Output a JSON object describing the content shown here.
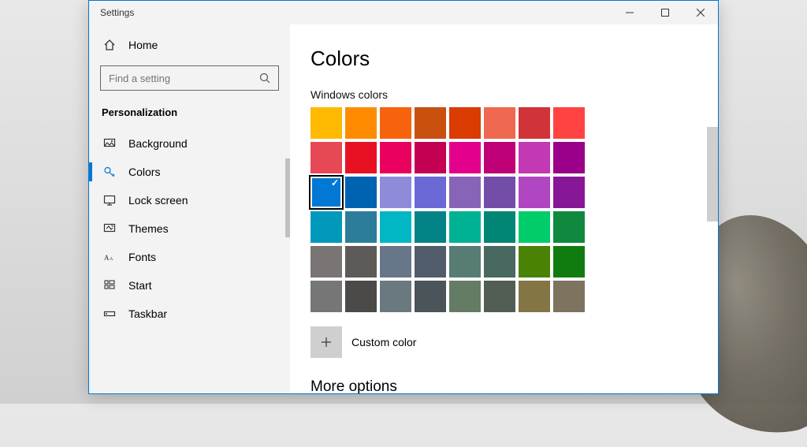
{
  "window": {
    "title": "Settings"
  },
  "sidebar": {
    "home_label": "Home",
    "search_placeholder": "Find a setting",
    "heading": "Personalization",
    "items": [
      {
        "label": "Background"
      },
      {
        "label": "Colors"
      },
      {
        "label": "Lock screen"
      },
      {
        "label": "Themes"
      },
      {
        "label": "Fonts"
      },
      {
        "label": "Start"
      },
      {
        "label": "Taskbar"
      }
    ],
    "active_index": 1
  },
  "content": {
    "title": "Colors",
    "swatch_heading": "Windows colors",
    "custom_label": "Custom color",
    "more_options": "More options",
    "selected_color_index": 16,
    "colors": [
      "#ffb900",
      "#ff8c00",
      "#f7630c",
      "#ca5010",
      "#da3b01",
      "#ef6950",
      "#d13438",
      "#ff4343",
      "#e74856",
      "#e81123",
      "#ea005e",
      "#c30052",
      "#e3008c",
      "#bf0077",
      "#c239b3",
      "#9a0089",
      "#0078d4",
      "#0063b1",
      "#8e8cd8",
      "#6b69d6",
      "#8764b8",
      "#744da9",
      "#b146c2",
      "#881798",
      "#0099bc",
      "#2d7d9a",
      "#00b7c3",
      "#038387",
      "#00b294",
      "#018574",
      "#00cc6a",
      "#10893e",
      "#7a7574",
      "#5d5a58",
      "#68768a",
      "#515c6b",
      "#567c73",
      "#486860",
      "#498205",
      "#107c10",
      "#767676",
      "#4c4a48",
      "#69797e",
      "#4a5459",
      "#647c64",
      "#525e54",
      "#847545",
      "#7e735f"
    ]
  }
}
